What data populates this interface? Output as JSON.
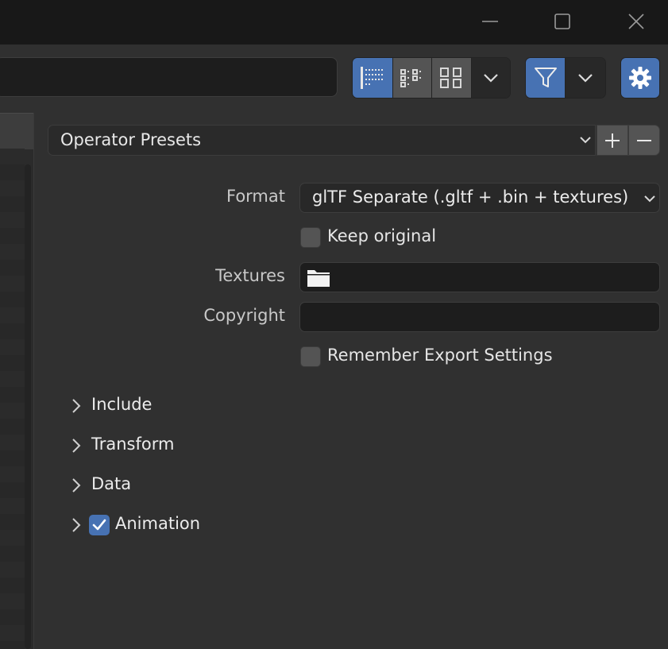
{
  "window_controls": {
    "minimize_icon": "minimize-icon",
    "maximize_icon": "maximize-icon",
    "close_icon": "close-icon"
  },
  "toolbar": {
    "path_value": "",
    "display_modes": [
      "vertical-list-icon",
      "horizontal-list-icon",
      "thumbnails-icon"
    ],
    "active_display_mode": "vertical-list-icon",
    "filter_active": true,
    "accent_color": "#4772b3"
  },
  "presets": {
    "label": "Operator Presets",
    "add_icon": "plus-icon",
    "remove_icon": "minus-icon"
  },
  "settings": {
    "format_label": "Format",
    "format_value": "glTF Separate (.gltf + .bin + textures)",
    "keep_original_label": "Keep original",
    "keep_original_checked": false,
    "textures_label": "Textures",
    "textures_value": "",
    "copyright_label": "Copyright",
    "copyright_value": "",
    "remember_label": "Remember Export Settings",
    "remember_checked": false
  },
  "sections": [
    {
      "label": "Include",
      "expanded": false,
      "has_checkbox": false
    },
    {
      "label": "Transform",
      "expanded": false,
      "has_checkbox": false
    },
    {
      "label": "Data",
      "expanded": false,
      "has_checkbox": false
    },
    {
      "label": "Animation",
      "expanded": false,
      "has_checkbox": true,
      "checked": true
    }
  ]
}
